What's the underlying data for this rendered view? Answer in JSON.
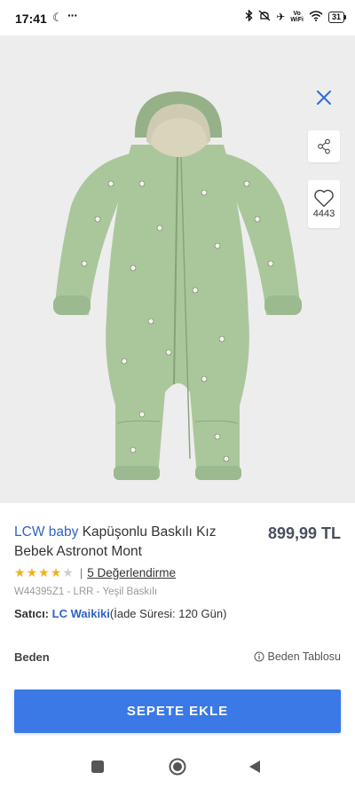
{
  "status_bar": {
    "time": "17:41",
    "battery": "31",
    "volte_top": "Vo",
    "volte_bottom": "WiFi"
  },
  "product": {
    "brand": "LCW baby",
    "name": "Kapüşonlu Baskılı Kız Bebek Astronot Mont",
    "price": "899,99 TL",
    "rating_stars": 4,
    "rating_max": 5,
    "reviews_link": "5 Değerlendirme",
    "sku_line": "W44395Z1 - LRR - Yeşil Baskılı",
    "seller_label": "Satıcı:",
    "seller_name": "LC Waikiki",
    "return_period": "(İade Süresi: 120 Gün)",
    "favorites_count": "4443",
    "image_count": 3,
    "active_image": 0
  },
  "size_section": {
    "label": "Beden",
    "size_chart_label": "Beden Tablosu"
  },
  "cta": {
    "add_to_cart_label": "SEPETE EKLE"
  },
  "colors": {
    "accent": "#3a79e6",
    "brand_link": "#2e63c4",
    "star": "#f2b01e",
    "garment": "#a9c49a"
  },
  "icons": [
    "close-icon",
    "share-icon",
    "heart-icon",
    "info-icon",
    "recent-apps-icon",
    "home-icon",
    "back-icon"
  ]
}
